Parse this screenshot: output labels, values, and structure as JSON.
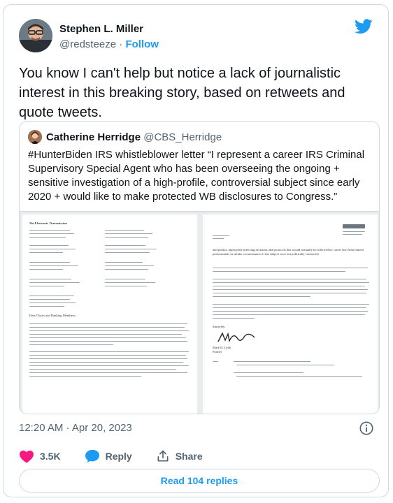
{
  "author": {
    "name": "Stephen L. Miller",
    "handle": "@redsteeze",
    "separator": "·",
    "follow_label": "Follow"
  },
  "tweet": {
    "text": "You know I can't help but notice a lack of journalistic interest in this breaking story, based on retweets and quote tweets.",
    "timestamp": "12:20 AM · Apr 20, 2023"
  },
  "quoted_tweet": {
    "name": "Catherine Herridge",
    "handle": "@CBS_Herridge",
    "text": "#HunterBiden IRS whistleblower letter “I represent a career IRS Criminal Supervisory Special Agent who has been overseeing the ongoing + sensitive investigation of a high-profile, controversial subject since early 2020 + would like to make protected WB disclosures to Congress.”",
    "media": {
      "left_header": "Via Electronic Transmission",
      "left_body": "Dear Chairs and Ranking Members:",
      "right_body": "and politics improperly infecting decisions and protocols that would normally be followed by career law enforcement professionals in similar circumstances if the subject were not politically connected.",
      "right_sign": "Sincerely,",
      "right_name": "Mark D. Lytle",
      "right_title": "Partner"
    }
  },
  "actions": {
    "like_count": "3.5K",
    "reply_label": "Reply",
    "share_label": "Share"
  },
  "read_replies_label": "Read 104 replies",
  "colors": {
    "accent": "#1d9bf0",
    "like": "#f91880",
    "text_secondary": "#536471",
    "border": "#cfd9de"
  },
  "icons": [
    "twitter-logo-icon",
    "info-icon",
    "heart-icon",
    "reply-icon",
    "share-icon"
  ]
}
